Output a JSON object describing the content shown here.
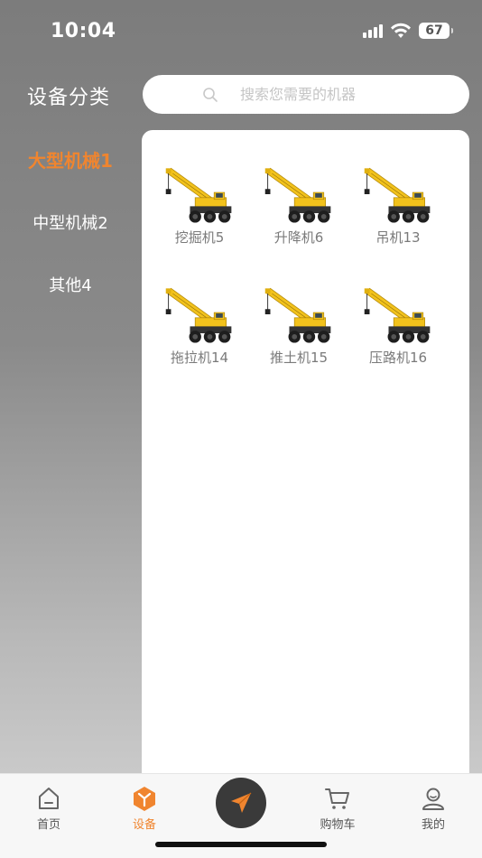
{
  "status": {
    "time": "10:04",
    "battery": "67"
  },
  "sidebar": {
    "title": "设备分类",
    "categories": [
      {
        "label": "大型机械1",
        "active": true
      },
      {
        "label": "中型机械2",
        "active": false
      },
      {
        "label": "其他4",
        "active": false
      }
    ]
  },
  "search": {
    "placeholder": "搜索您需要的机器",
    "value": ""
  },
  "products": [
    {
      "label": "挖掘机5",
      "icon": "crane-image"
    },
    {
      "label": "升降机6",
      "icon": "crane-image"
    },
    {
      "label": "吊机13",
      "icon": "crane-image"
    },
    {
      "label": "拖拉机14",
      "icon": "crane-image"
    },
    {
      "label": "推土机15",
      "icon": "crane-image"
    },
    {
      "label": "压路机16",
      "icon": "crane-image"
    }
  ],
  "tabbar": {
    "items": [
      {
        "label": "首页",
        "icon": "home-icon"
      },
      {
        "label": "设备",
        "icon": "equipment-icon",
        "active": true
      },
      {
        "label": "",
        "icon": "send-icon"
      },
      {
        "label": "购物车",
        "icon": "cart-icon"
      },
      {
        "label": "我的",
        "icon": "user-icon"
      }
    ]
  },
  "colors": {
    "accent": "#f0852f",
    "center_button": "#3a3a3a"
  }
}
